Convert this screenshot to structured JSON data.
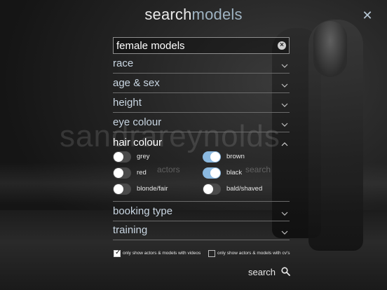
{
  "header": {
    "title_part1": "search",
    "title_part2": "models",
    "close_icon": "close-icon"
  },
  "search": {
    "value": "female models"
  },
  "watermark": "sandrareynolds",
  "ghost": {
    "left": "actors",
    "right": "search"
  },
  "sections": {
    "race": {
      "label": "race",
      "expanded": false
    },
    "age_sex": {
      "label": "age & sex",
      "expanded": false
    },
    "height": {
      "label": "height",
      "expanded": false
    },
    "eye_colour": {
      "label": "eye colour",
      "expanded": false
    },
    "hair_colour": {
      "label": "hair colour",
      "expanded": true,
      "options": {
        "grey": {
          "label": "grey",
          "on": false
        },
        "brown": {
          "label": "brown",
          "on": true
        },
        "red": {
          "label": "red",
          "on": false
        },
        "black": {
          "label": "black",
          "on": true
        },
        "blonde_fair": {
          "label": "blonde/fair",
          "on": false
        },
        "bald_shaved": {
          "label": "bald/shaved",
          "on": false
        }
      }
    },
    "booking_type": {
      "label": "booking type",
      "expanded": false
    },
    "training": {
      "label": "training",
      "expanded": false
    }
  },
  "filters": {
    "videos": {
      "label": "only show actors & models with videos",
      "checked": true
    },
    "cvs": {
      "label": "only show actors & models with cv's",
      "checked": false
    }
  },
  "action": {
    "search_label": "search",
    "icon": "search-icon"
  },
  "colors": {
    "accent": "#8bb9e0",
    "title_light": "#9fb3c2"
  }
}
